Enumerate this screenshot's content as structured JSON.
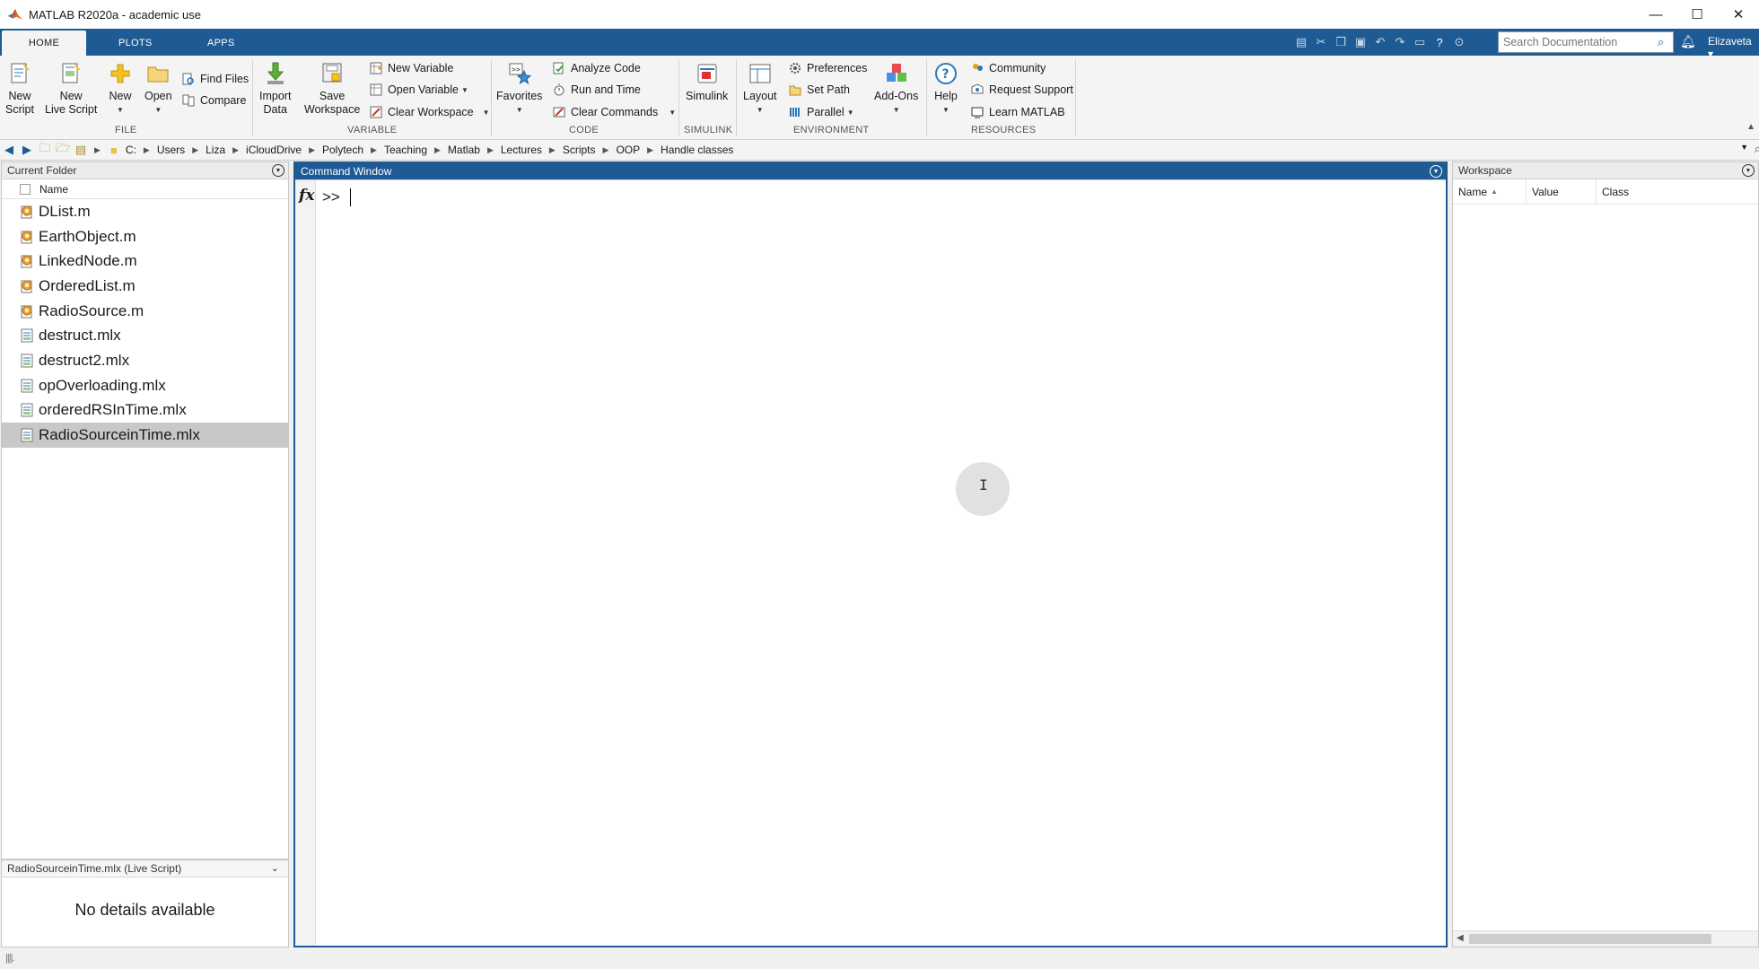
{
  "window": {
    "title": "MATLAB R2020a - academic use",
    "min": "—",
    "max": "☐",
    "close": "✕"
  },
  "tabs": [
    {
      "label": "HOME"
    },
    {
      "label": "PLOTS"
    },
    {
      "label": "APPS"
    }
  ],
  "search": {
    "placeholder": "Search Documentation"
  },
  "user": {
    "name": "Elizaveta ▾"
  },
  "ribbon": {
    "file": {
      "label": "FILE",
      "new_script": [
        "New",
        "Script"
      ],
      "new_live_script": [
        "New",
        "Live Script"
      ],
      "new": "New",
      "open": "Open",
      "find_files": "Find Files",
      "compare": "Compare"
    },
    "variable": {
      "label": "VARIABLE",
      "import_data": [
        "Import",
        "Data"
      ],
      "save_workspace": [
        "Save",
        "Workspace"
      ],
      "new_variable": "New Variable",
      "open_variable": "Open Variable",
      "clear_workspace": "Clear Workspace"
    },
    "code": {
      "label": "CODE",
      "favorites": "Favorites",
      "analyze_code": "Analyze Code",
      "run_and_time": "Run and Time",
      "clear_commands": "Clear Commands"
    },
    "simulink": {
      "label": "SIMULINK",
      "simulink": "Simulink"
    },
    "environment": {
      "label": "ENVIRONMENT",
      "layout": "Layout",
      "preferences": "Preferences",
      "set_path": "Set Path",
      "parallel": "Parallel",
      "add_ons": "Add-Ons"
    },
    "resources": {
      "label": "RESOURCES",
      "help": "Help",
      "community": "Community",
      "request_support": "Request Support",
      "learn_matlab": "Learn MATLAB"
    }
  },
  "path": [
    "C:",
    "Users",
    "Liza",
    "iCloudDrive",
    "Polytech",
    "Teaching",
    "Matlab",
    "Lectures",
    "Scripts",
    "OOP",
    "Handle classes"
  ],
  "current_folder": {
    "title": "Current Folder",
    "column": "Name",
    "files": [
      {
        "name": "DList.m",
        "kind": "class"
      },
      {
        "name": "EarthObject.m",
        "kind": "class"
      },
      {
        "name": "LinkedNode.m",
        "kind": "class"
      },
      {
        "name": "OrderedList.m",
        "kind": "class"
      },
      {
        "name": "RadioSource.m",
        "kind": "class"
      },
      {
        "name": "destruct.mlx",
        "kind": "live"
      },
      {
        "name": "destruct2.mlx",
        "kind": "live"
      },
      {
        "name": "opOverloading.mlx",
        "kind": "live"
      },
      {
        "name": "orderedRSInTime.mlx",
        "kind": "live"
      },
      {
        "name": "RadioSourceinTime.mlx",
        "kind": "live",
        "selected": true
      }
    ],
    "details_title": "RadioSourceinTime.mlx  (Live Script)",
    "details_text": "No details available"
  },
  "command_window": {
    "title": "Command Window",
    "fx": "fx",
    "prompt": ">>"
  },
  "workspace": {
    "title": "Workspace",
    "columns": [
      "Name",
      "Value",
      "Class"
    ]
  },
  "colors": {
    "accent": "#1e5b94",
    "selected_row": "#c8c8c8"
  }
}
